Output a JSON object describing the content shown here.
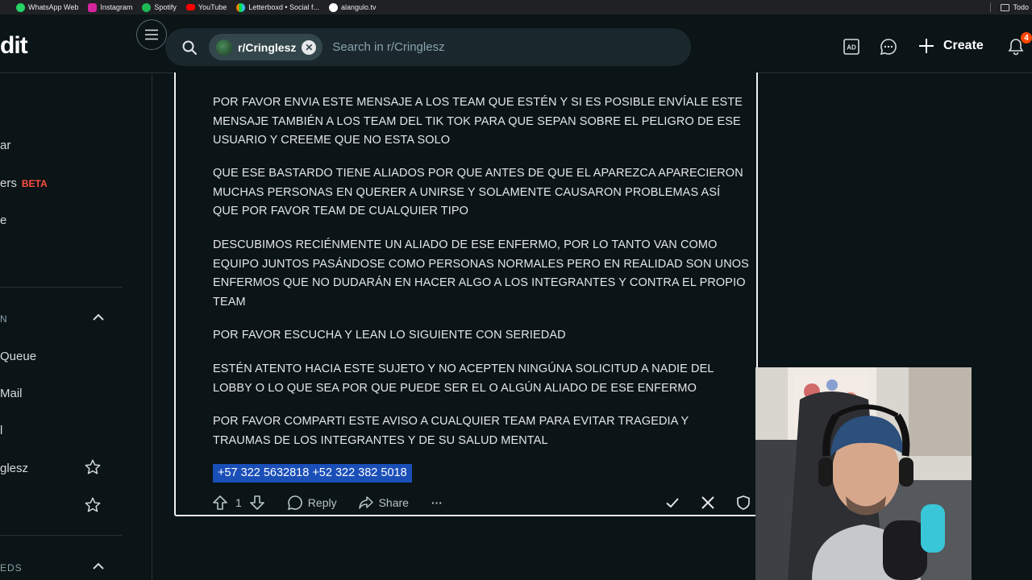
{
  "bookmarks": [
    {
      "label": "WhatsApp Web",
      "color": "#25d366"
    },
    {
      "label": "Instagram",
      "color": "#d6249f"
    },
    {
      "label": "Spotify",
      "color": "#1db954"
    },
    {
      "label": "YouTube",
      "color": "#ff0000"
    },
    {
      "label": "Letterboxd • Social f...",
      "color": "#778899"
    },
    {
      "label": "alangulo.tv",
      "color": "#ffffff"
    }
  ],
  "bookmarks_right": "Todo",
  "header": {
    "logo": "dit",
    "subreddit_chip": "r/Cringlesz",
    "search_placeholder": "Search in r/Cringlesz",
    "create_label": "Create",
    "notification_count": "4"
  },
  "sidebar": {
    "items": [
      {
        "label": "ar"
      },
      {
        "label": "ers",
        "badge": "BETA"
      },
      {
        "label": "e"
      }
    ],
    "section_mod": "N",
    "mod_items": [
      {
        "label": "Queue"
      },
      {
        "label": "Mail"
      },
      {
        "label": "l"
      },
      {
        "label": "glesz"
      },
      {
        "label": ""
      }
    ],
    "section_feeds": "EDS"
  },
  "comment": {
    "paragraphs": [
      "POR FAVOR ENVIA ESTE MENSAJE A LOS TEAM QUE ESTÉN Y SI ES POSIBLE ENVÍALE ESTE MENSAJE TAMBIÉN A LOS TEAM DEL TIK TOK PARA QUE SEPAN SOBRE EL PELIGRO DE ESE USUARIO Y CREEME QUE NO ESTA SOLO",
      "QUE ESE BASTARDO TIENE ALIADOS POR QUE ANTES DE QUE EL APAREZCA APARECIERON MUCHAS PERSONAS EN QUERER A UNIRSE Y SOLAMENTE CAUSARON PROBLEMAS ASÍ QUE POR FAVOR TEAM DE CUALQUIER TIPO",
      "DESCUBIMOS RECIÉNMENTE UN ALIADO DE ESE ENFERMO, POR LO TANTO VAN COMO EQUIPO JUNTOS PASÁNDOSE COMO PERSONAS NORMALES PERO EN REALIDAD SON UNOS ENFERMOS QUE NO DUDARÁN EN HACER ALGO A LOS INTEGRANTES Y CONTRA EL PROPIO TEAM",
      "POR FAVOR ESCUCHA Y LEAN LO SIGUIENTE CON SERIEDAD",
      "ESTÉN ATENTO HACIA ESTE SUJETO Y NO ACEPTEN NINGÚNA SOLICITUD A NADIE DEL LOBBY O LO QUE SEA POR QUE PUEDE SER EL O ALGÚN ALIADO DE ESE ENFERMO",
      "POR FAVOR COMPARTI ESTE AVISO A CUALQUIER TEAM PARA EVITAR TRAGEDIA Y TRAUMAS DE LOS INTEGRANTES Y DE SU SALUD MENTAL"
    ],
    "phone_numbers": "+57 322 5632818 +52 322 382 5018",
    "vote_count": "1",
    "reply_label": "Reply",
    "share_label": "Share",
    "more_label": "···"
  },
  "colors": {
    "background": "#0b1416",
    "accent": "#ff4500",
    "selection": "#1a4fb8"
  }
}
